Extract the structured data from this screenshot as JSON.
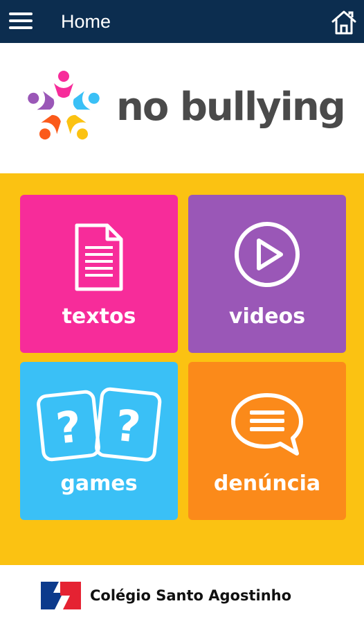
{
  "app_bar": {
    "title": "Home",
    "menu_icon": "hamburger-menu-icon",
    "home_icon": "home-icon",
    "background": "#0c2d4f"
  },
  "brand": {
    "logo_text": "no bullying",
    "logo_icon": "people-star-logo",
    "text_color": "#4a4a4a"
  },
  "grid": {
    "background": "#fbc212",
    "tiles": [
      {
        "label": "textos",
        "icon": "document-icon",
        "color": "#f72c9a"
      },
      {
        "label": "videos",
        "icon": "play-circle-icon",
        "color": "#9a57b7"
      },
      {
        "label": "games",
        "icon": "question-cards-icon",
        "color": "#3ac0f6"
      },
      {
        "label": "denúncia",
        "icon": "speech-bubble-icon",
        "color": "#fb8a1a"
      }
    ]
  },
  "footer": {
    "school_name": "Colégio Santo Agostinho",
    "school_logo": "school-logo"
  }
}
